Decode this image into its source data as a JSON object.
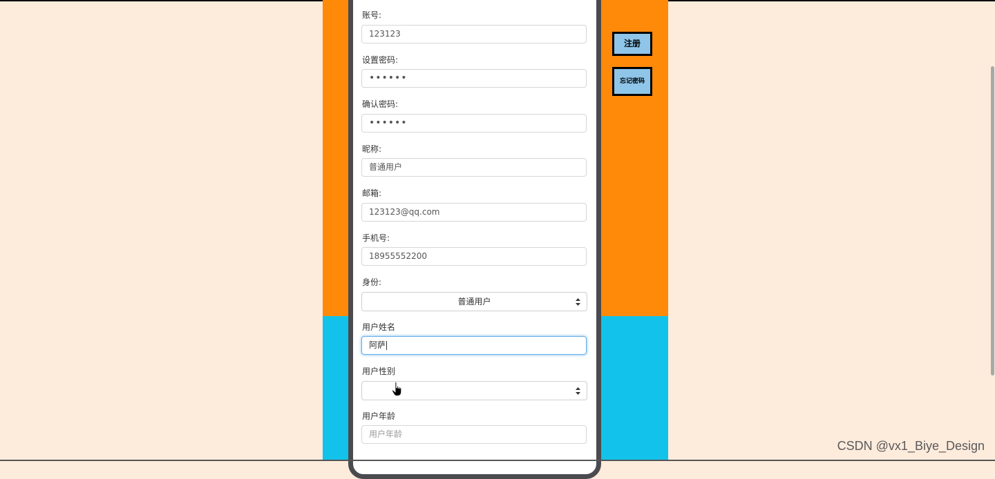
{
  "form": {
    "account": {
      "label": "账号:",
      "value": "123123"
    },
    "password": {
      "label": "设置密码:",
      "value": "••••••"
    },
    "confirm_password": {
      "label": "确认密码:",
      "value": "••••••"
    },
    "nickname": {
      "label": "昵称:",
      "value": "普通用户"
    },
    "email": {
      "label": "邮箱:",
      "value": "123123@qq.com"
    },
    "phone": {
      "label": "手机号:",
      "value": "18955552200"
    },
    "role": {
      "label": "身份:",
      "selected": "普通用户"
    },
    "real_name": {
      "label": "用户姓名",
      "value": "阿萨"
    },
    "gender": {
      "label": "用户性别",
      "selected": ""
    },
    "age": {
      "label": "用户年龄",
      "placeholder": "用户年龄"
    }
  },
  "side_buttons": {
    "register": "注册",
    "forgot_password": "忘记密码"
  },
  "watermark": "CSDN @vx1_Biye_Design",
  "colors": {
    "page_bg": "#fdebdc",
    "orange_panel": "#ff8a0a",
    "blue_panel": "#13c2ea",
    "button_bg": "#8ec5e8",
    "focus_border": "#66afe9"
  }
}
